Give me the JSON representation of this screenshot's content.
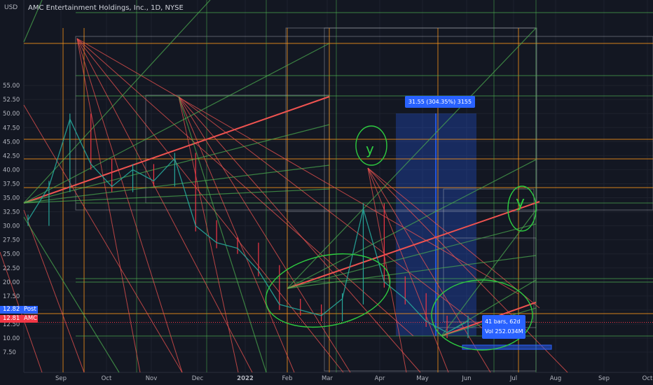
{
  "header": {
    "title": "AMC Entertainment Holdings, Inc., 1D, NYSE",
    "currency": "USD"
  },
  "price_tags": {
    "post": {
      "value": "12.82",
      "label": "Post",
      "color": "#2962ff"
    },
    "last": {
      "value": "12.81",
      "label": "AMC",
      "color": "#f23645"
    }
  },
  "measure_box": {
    "label": "31.55 (304.35%) 3155"
  },
  "date_range": {
    "bars": "41 bars, 62d",
    "volume": "Vol 252.034M"
  },
  "annotations": {
    "letter_y": "y"
  },
  "chart_data": {
    "type": "line",
    "title": "AMC Entertainment Holdings, Inc., 1D, NYSE",
    "xlabel": "",
    "ylabel": "USD",
    "ylim": [
      5.5,
      57
    ],
    "y_ticks": [
      7.5,
      10,
      12.5,
      15,
      17.5,
      20,
      22.5,
      25,
      27.5,
      30,
      32.5,
      35,
      37.5,
      40,
      42.5,
      45,
      47.5,
      50,
      52.5,
      55
    ],
    "y_tick_labels": [
      "7.50",
      "10.00",
      "12.50",
      "15.00",
      "17.50",
      "20.00",
      "22.50",
      "25.00",
      "27.50",
      "30.00",
      "32.50",
      "35.00",
      "37.50",
      "40.00",
      "42.50",
      "45.00",
      "47.50",
      "50.00",
      "52.50",
      "55.00"
    ],
    "x_ticks": [
      "Sep",
      "Oct",
      "Nov",
      "Dec",
      "2022",
      "Feb",
      "Mar",
      "Apr",
      "May",
      "Jun",
      "Jul",
      "Aug",
      "Sep",
      "Oct"
    ],
    "grid": true,
    "legend": "none",
    "series": [
      {
        "name": "AMC",
        "color": "#26a69a",
        "x": [
          "Aug 20",
          "Sep 1",
          "Sep 13",
          "Sep 24",
          "Oct 8",
          "Oct 22",
          "Nov 5",
          "Nov 19",
          "Dec 3",
          "Dec 17",
          "Dec 31",
          "Jan 14",
          "Jan 28",
          "Feb 11",
          "Feb 25",
          "Mar 11",
          "Mar 25",
          "Apr 8",
          "Apr 22",
          "May 6",
          "May 20",
          "Jun 3"
        ],
        "values": [
          31,
          37,
          49,
          41,
          37,
          40,
          38,
          42,
          30,
          27,
          26,
          22,
          16,
          15,
          14,
          17,
          33,
          20,
          17,
          13,
          11,
          13
        ]
      }
    ],
    "current_price": 12.81
  },
  "colors": {
    "background": "#131722",
    "up": "#26a69a",
    "down": "#f23645",
    "accent": "#2962ff",
    "orange_line": "#f7931a",
    "green_line": "#4caf50",
    "red_line": "#ef5350"
  }
}
